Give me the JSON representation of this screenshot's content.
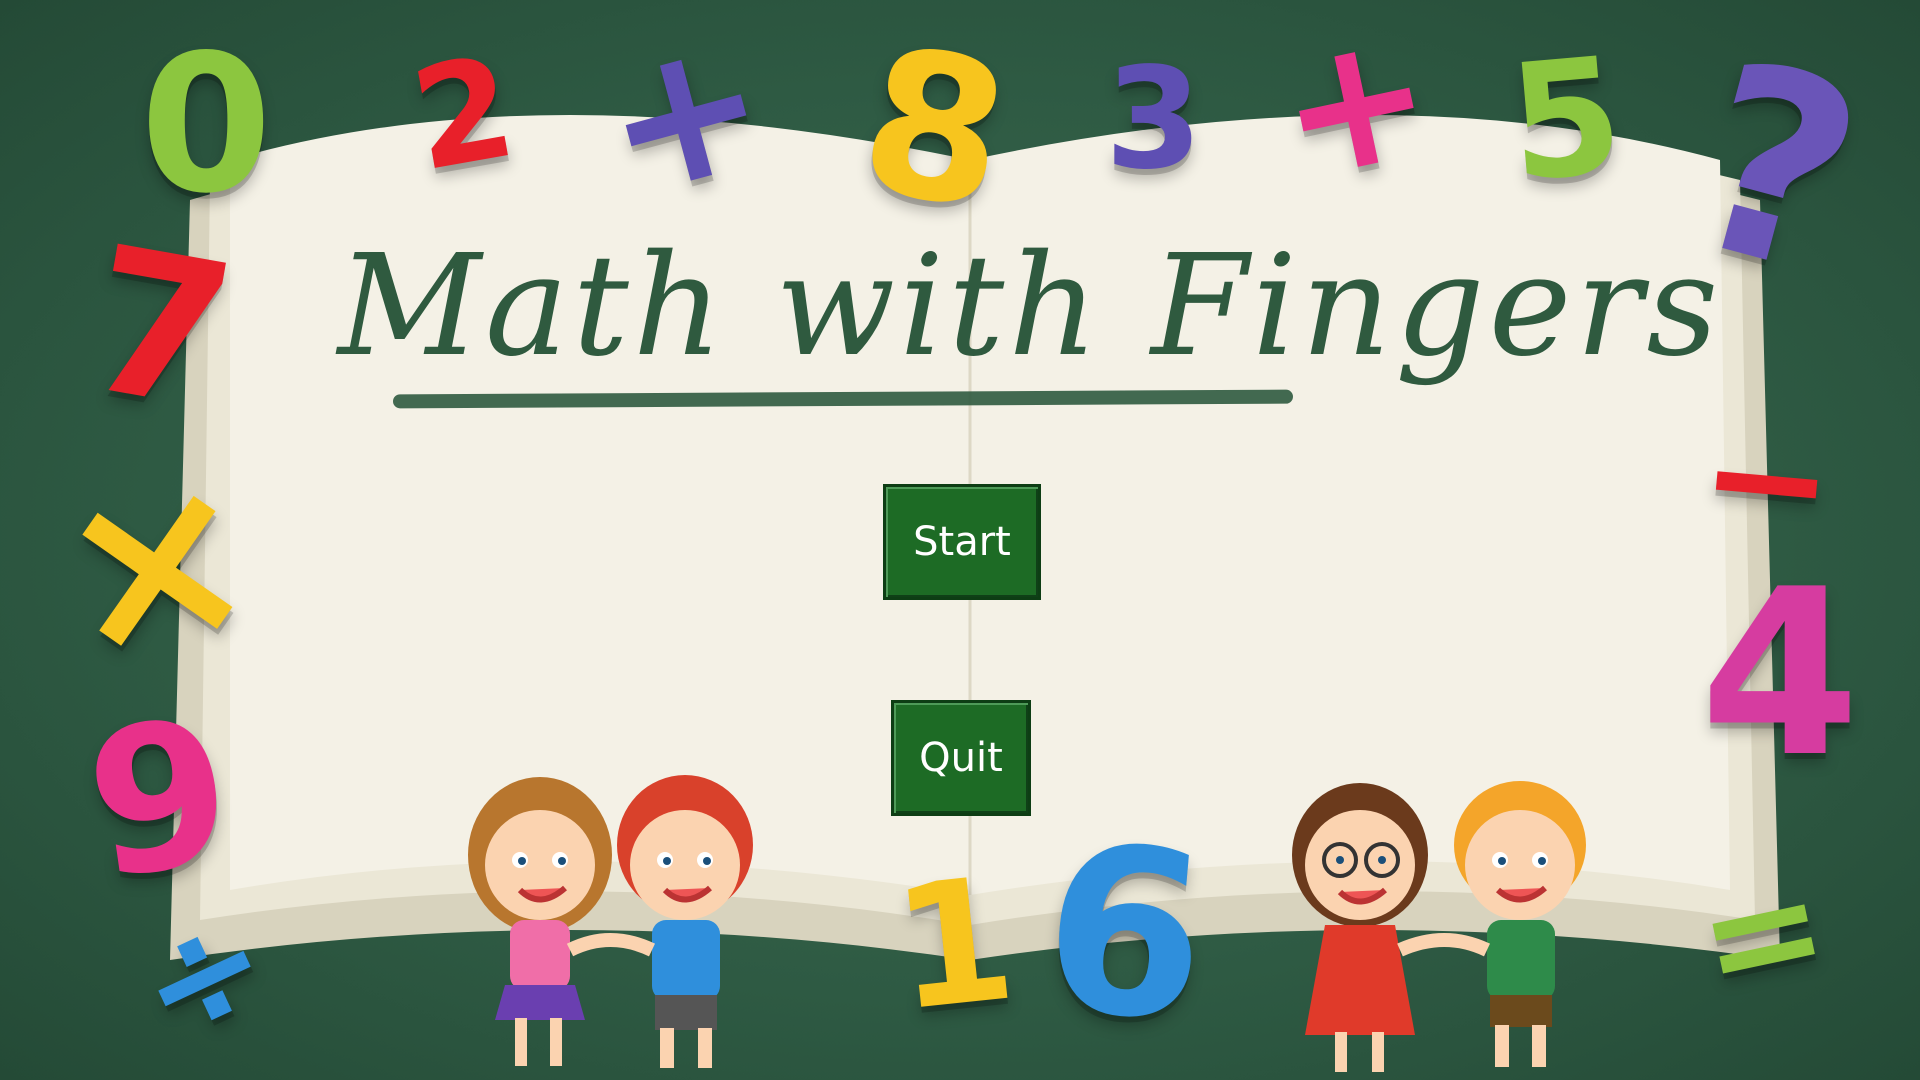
{
  "title": "Math with Fingers",
  "buttons": {
    "start": "Start",
    "quit": "Quit"
  },
  "decorations": {
    "digit_0": "0",
    "digit_2": "2",
    "plus_top_left": "+",
    "digit_8": "8",
    "digit_3": "3",
    "plus_top_right": "+",
    "digit_5": "5",
    "question": "?",
    "digit_7": "7",
    "times": "×",
    "digit_9": "9",
    "divide": "÷",
    "minus": "−",
    "digit_4": "4",
    "equals": "=",
    "digit_1": "1",
    "digit_6": "6"
  },
  "colors": {
    "board": "#2e5a43",
    "page": "#f4f1e6",
    "button": "#1d6b25",
    "title": "#2f5a3f"
  }
}
